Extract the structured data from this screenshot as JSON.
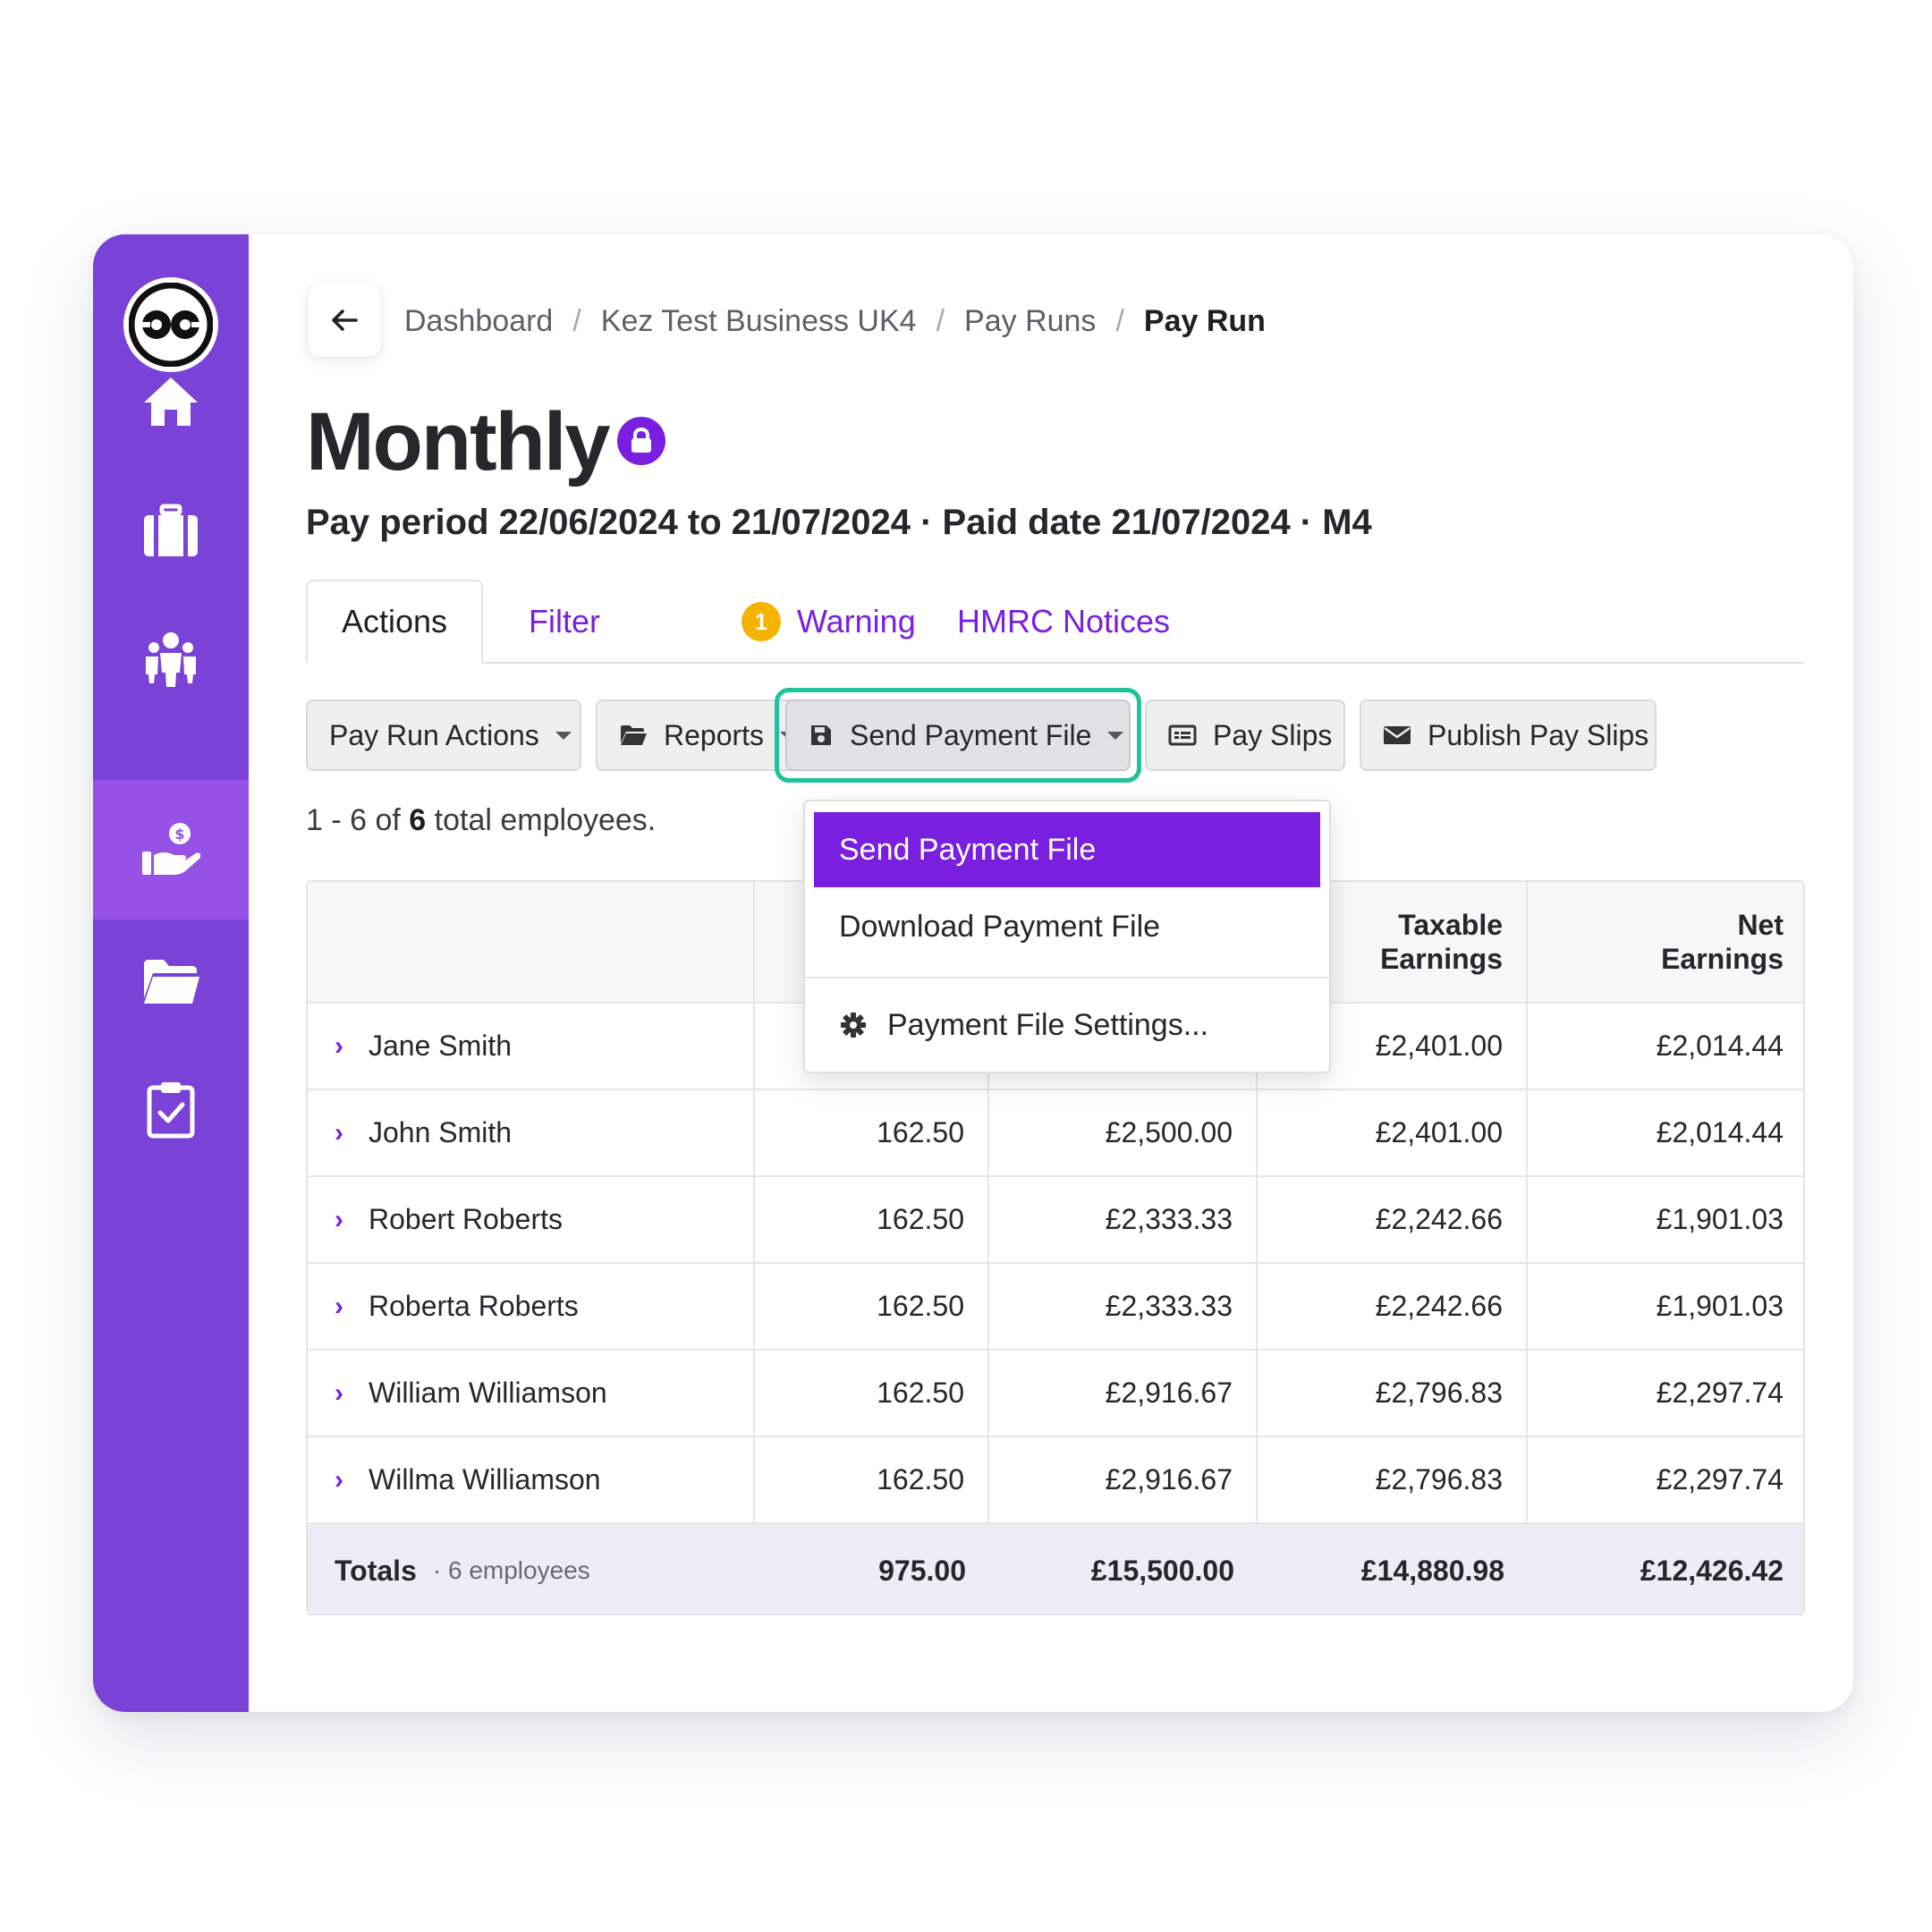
{
  "breadcrumb": {
    "items": [
      "Dashboard",
      "Kez Test Business UK4",
      "Pay Runs"
    ],
    "current": "Pay Run",
    "separator": "/"
  },
  "header": {
    "title": "Monthly",
    "pay_period": "Pay period 22/06/2024 to 21/07/2024 · Paid date 21/07/2024 · M4"
  },
  "tabs": {
    "actions": "Actions",
    "filter": "Filter",
    "warning_count": "1",
    "warning": "Warning",
    "hmrc": "HMRC Notices"
  },
  "toolbar": {
    "pay_run_actions": "Pay Run Actions",
    "reports": "Reports",
    "send_payment_file": "Send Payment File",
    "pay_slips": "Pay Slips",
    "publish_pay_slips": "Publish Pay Slips"
  },
  "results": {
    "prefix": "1 - 6 of",
    "total": "6",
    "suffix": "total employees."
  },
  "dropdown": {
    "items": [
      "Send Payment File",
      "Download Payment File",
      "Payment File Settings..."
    ]
  },
  "table": {
    "headers": {
      "taxable_line1": "Taxable",
      "taxable_line2": "Earnings",
      "net_line1": "Net",
      "net_line2": "Earnings"
    },
    "rows": [
      {
        "name": "Jane Smith",
        "hours": "",
        "gross": "",
        "taxable": "£2,401.00",
        "net": "£2,014.44"
      },
      {
        "name": "John Smith",
        "hours": "162.50",
        "gross": "£2,500.00",
        "taxable": "£2,401.00",
        "net": "£2,014.44"
      },
      {
        "name": "Robert Roberts",
        "hours": "162.50",
        "gross": "£2,333.33",
        "taxable": "£2,242.66",
        "net": "£1,901.03"
      },
      {
        "name": "Roberta Roberts",
        "hours": "162.50",
        "gross": "£2,333.33",
        "taxable": "£2,242.66",
        "net": "£1,901.03"
      },
      {
        "name": "William Williamson",
        "hours": "162.50",
        "gross": "£2,916.67",
        "taxable": "£2,796.83",
        "net": "£2,297.74"
      },
      {
        "name": "Willma Williamson",
        "hours": "162.50",
        "gross": "£2,916.67",
        "taxable": "£2,796.83",
        "net": "£2,297.74"
      }
    ],
    "totals": {
      "label": "Totals",
      "sub": "· 6 employees",
      "hours": "975.00",
      "gross": "£15,500.00",
      "taxable": "£14,880.98",
      "net": "£12,426.42"
    }
  },
  "colors": {
    "sidebar": "#7a42d6",
    "sidebar_active": "#9652e6",
    "accent": "#7a1fe0",
    "focus": "#1fc29a",
    "warning": "#f4b400"
  },
  "icons": {
    "sidebar": [
      "logo-icon",
      "home-icon",
      "briefcase-icon",
      "people-icon",
      "payment-hand-icon",
      "folder-icon",
      "clipboard-check-icon"
    ],
    "toolbar": [
      "folder-open-icon",
      "save-icon",
      "payslip-icon",
      "envelope-icon",
      "gear-icon"
    ]
  }
}
